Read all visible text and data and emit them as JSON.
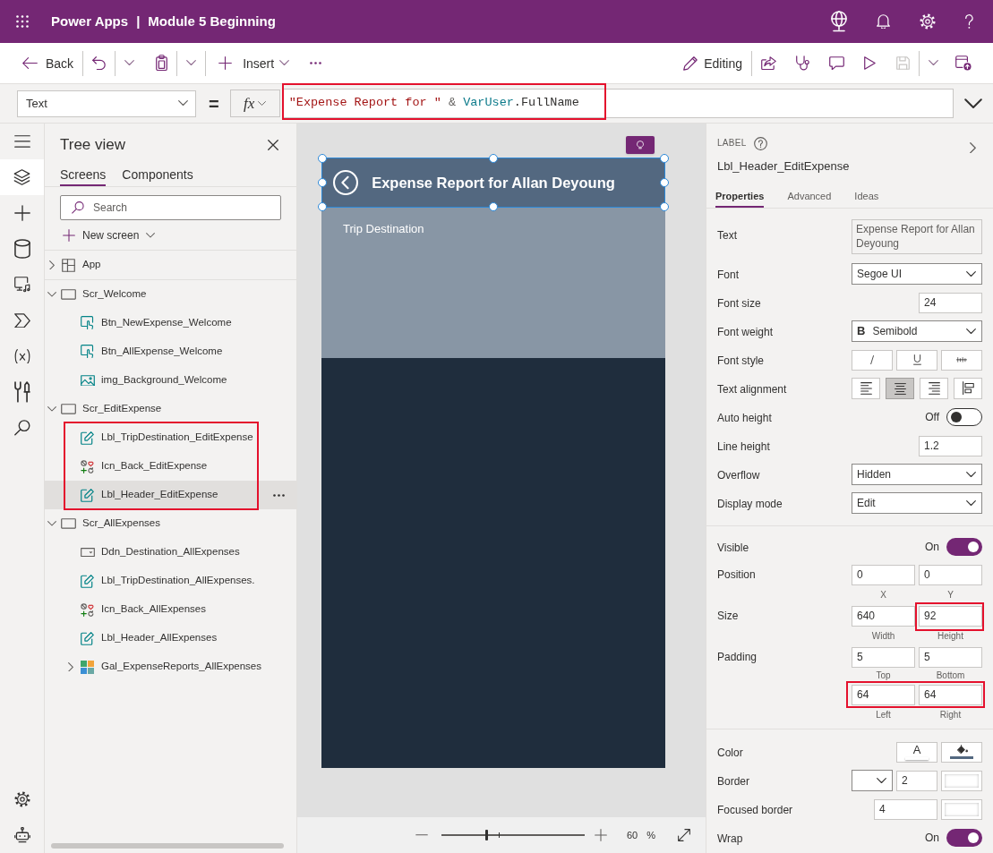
{
  "top_bar": {
    "app_name": "Power Apps",
    "separator": "|",
    "document_title": "Module 5 Beginning",
    "icons": [
      {
        "kind": "environment"
      },
      {
        "kind": "notifications"
      },
      {
        "kind": "settings"
      },
      {
        "kind": "help"
      }
    ]
  },
  "toolbar": {
    "left": [
      {
        "kind": "back",
        "label": "Back"
      },
      {
        "kind": "divider"
      },
      {
        "kind": "undo"
      },
      {
        "kind": "divider"
      },
      {
        "kind": "chevron"
      },
      {
        "kind": "paste"
      },
      {
        "kind": "divider"
      },
      {
        "kind": "chevron"
      },
      {
        "kind": "divider"
      },
      {
        "kind": "insert",
        "label": "Insert"
      },
      {
        "kind": "more"
      }
    ],
    "right": [
      {
        "kind": "editing",
        "label": "Editing"
      },
      {
        "kind": "divider"
      },
      {
        "kind": "share",
        "disabled": false
      },
      {
        "kind": "checker",
        "disabled": false
      },
      {
        "kind": "comments",
        "disabled": false
      },
      {
        "kind": "preview",
        "disabled": false
      },
      {
        "kind": "save",
        "disabled": true
      },
      {
        "kind": "divider"
      },
      {
        "kind": "chevron",
        "disabled": false
      },
      {
        "kind": "publish",
        "disabled": false
      }
    ]
  },
  "formula_bar": {
    "property": "Text",
    "operator": "=",
    "function_label": "fx",
    "formula": [
      {
        "kind": "string",
        "text": "\"Expense Report for \""
      },
      {
        "kind": "operator",
        "text": " & "
      },
      {
        "kind": "variable",
        "text": "VarUser"
      },
      {
        "kind": "member",
        "text": ".FullName"
      }
    ],
    "highlighted": true
  },
  "rail": {
    "items": [
      {
        "kind": "menu",
        "selected": false
      },
      {
        "kind": "tree",
        "selected": true
      },
      {
        "kind": "insert",
        "selected": false
      },
      {
        "kind": "data",
        "selected": false
      },
      {
        "kind": "media",
        "selected": false
      },
      {
        "kind": "automate",
        "selected": false
      },
      {
        "kind": "variables",
        "selected": false
      },
      {
        "kind": "tools",
        "selected": false
      },
      {
        "kind": "search",
        "selected": false
      }
    ],
    "bottom": [
      {
        "kind": "settings",
        "selected": false
      },
      {
        "kind": "virtual-agent",
        "selected": false
      }
    ]
  },
  "tree_view": {
    "title": "Tree view",
    "tabs": [
      {
        "label": "Screens",
        "selected": true
      },
      {
        "label": "Components",
        "selected": false
      }
    ],
    "search": {
      "placeholder": "Search"
    },
    "new_screen": "New screen",
    "items": [
      {
        "label": "App",
        "kind": "app",
        "expanded": false,
        "selected": false
      },
      {
        "label": "Scr_Welcome",
        "kind": "screen",
        "expanded": true,
        "selected": false,
        "children_highlighted": false,
        "children": [
          {
            "label": "Btn_NewExpense_Welcome",
            "kind": "button",
            "selected": false
          },
          {
            "label": "Btn_AllExpense_Welcome",
            "kind": "button",
            "selected": false
          },
          {
            "label": "img_Background_Welcome",
            "kind": "image",
            "selected": false
          }
        ]
      },
      {
        "label": "Scr_EditExpense",
        "kind": "screen",
        "expanded": true,
        "selected": false,
        "children_highlighted": true,
        "children": [
          {
            "label": "Lbl_TripDestination_EditExpense",
            "kind": "label",
            "selected": false
          },
          {
            "label": "Icn_Back_EditExpense",
            "kind": "icon",
            "selected": false
          },
          {
            "label": "Lbl_Header_EditExpense",
            "kind": "label",
            "selected": true
          }
        ]
      },
      {
        "label": "Scr_AllExpenses",
        "kind": "screen",
        "expanded": true,
        "selected": false,
        "children_highlighted": false,
        "children": [
          {
            "label": "Ddn_Destination_AllExpenses",
            "kind": "dropdown",
            "selected": false
          },
          {
            "label": "Lbl_TripDestination_AllExpenses.",
            "kind": "label",
            "selected": false
          },
          {
            "label": "Icn_Back_AllExpenses",
            "kind": "icon",
            "selected": false
          },
          {
            "label": "Lbl_Header_AllExpenses",
            "kind": "label",
            "selected": false
          },
          {
            "label": "Gal_ExpenseReports_AllExpenses",
            "kind": "gallery",
            "expanded": false,
            "selected": false
          }
        ]
      }
    ]
  },
  "canvas": {
    "screen": {
      "header": {
        "text": "Expense Report for Allan Deyoung",
        "selected": true
      },
      "section_label": "Trip Destination"
    },
    "zoom": {
      "level": 0.31,
      "value": "60",
      "unit": "%"
    }
  },
  "properties": {
    "control_type": "LABEL",
    "control_name": "Lbl_Header_EditExpense",
    "tabs": [
      {
        "label": "Properties",
        "selected": true
      },
      {
        "label": "Advanced",
        "selected": false
      },
      {
        "label": "Ideas",
        "selected": false
      }
    ],
    "sections": [
      {
        "rows": [
          {
            "kind": "controls",
            "label": "Text",
            "controls": [
              {
                "kind": "textarea",
                "value": "Expense Report for Allan Deyoung",
                "disabled": true
              }
            ]
          },
          {
            "kind": "controls",
            "label": "Font",
            "controls": [
              {
                "kind": "dropdown",
                "value": "Segoe UI"
              }
            ]
          },
          {
            "kind": "controls",
            "label": "Font size",
            "controls": [
              {
                "kind": "input",
                "value": "24"
              }
            ]
          },
          {
            "kind": "controls",
            "label": "Font weight",
            "controls": [
              {
                "kind": "dropdown",
                "prefix": "B",
                "value": "Semibold"
              }
            ]
          },
          {
            "kind": "controls",
            "label": "Font style",
            "controls": [
              {
                "kind": "italic",
                "selected": false
              },
              {
                "kind": "underline",
                "selected": false
              },
              {
                "kind": "strikethrough",
                "selected": false
              }
            ]
          },
          {
            "kind": "controls",
            "label": "Text alignment",
            "controls": [
              {
                "kind": "align-left",
                "selected": false
              },
              {
                "kind": "align-center",
                "selected": true
              },
              {
                "kind": "align-right",
                "selected": false
              },
              {
                "kind": "vertical-align",
                "selected": false
              }
            ]
          },
          {
            "kind": "controls",
            "label": "Auto height",
            "controls": [
              {
                "kind": "switch",
                "text": "Off",
                "on": false
              }
            ]
          },
          {
            "kind": "controls",
            "label": "Line height",
            "controls": [
              {
                "kind": "input",
                "value": "1.2"
              }
            ]
          },
          {
            "kind": "controls",
            "label": "Overflow",
            "controls": [
              {
                "kind": "dropdown",
                "value": "Hidden"
              }
            ]
          },
          {
            "kind": "controls",
            "label": "Display mode",
            "controls": [
              {
                "kind": "dropdown",
                "value": "Edit"
              }
            ]
          }
        ]
      },
      {
        "rows": [
          {
            "kind": "controls",
            "label": "Visible",
            "controls": [
              {
                "kind": "switch",
                "text": "On",
                "on": true
              }
            ]
          },
          {
            "kind": "pairs",
            "label": "Position",
            "pairs": [
              {
                "highlighted": false,
                "fields": [
                  {
                    "value": "0",
                    "caption": "X",
                    "highlighted": false
                  },
                  {
                    "value": "0",
                    "caption": "Y",
                    "highlighted": false
                  }
                ]
              }
            ]
          },
          {
            "kind": "pairs",
            "label": "Size",
            "pairs": [
              {
                "highlighted": false,
                "fields": [
                  {
                    "value": "640",
                    "caption": "Width",
                    "highlighted": false
                  },
                  {
                    "value": "92",
                    "caption": "Height",
                    "highlighted": true
                  }
                ]
              }
            ]
          },
          {
            "kind": "pairs",
            "label": "Padding",
            "pairs": [
              {
                "highlighted": false,
                "fields": [
                  {
                    "value": "5",
                    "caption": "Top",
                    "highlighted": false
                  },
                  {
                    "value": "5",
                    "caption": "Bottom",
                    "highlighted": false
                  }
                ]
              },
              {
                "highlighted": true,
                "fields": [
                  {
                    "value": "64",
                    "caption": "Left",
                    "highlighted": false
                  },
                  {
                    "value": "64",
                    "caption": "Right",
                    "highlighted": false
                  }
                ]
              }
            ]
          }
        ]
      },
      {
        "rows": [
          {
            "kind": "controls",
            "label": "Color",
            "controls": [
              {
                "kind": "text-color",
                "text": "A",
                "color": "#ffffff"
              },
              {
                "kind": "fill-color",
                "color": "#536880"
              }
            ]
          },
          {
            "kind": "controls",
            "label": "Border",
            "controls": [
              {
                "kind": "dropdown"
              },
              {
                "kind": "input",
                "value": "2"
              },
              {
                "kind": "swatch",
                "color": "#ffffff"
              }
            ]
          },
          {
            "kind": "controls",
            "label": "Focused border",
            "controls": [
              {
                "kind": "input",
                "value": "4"
              },
              {
                "kind": "swatch",
                "color": "#ffffff"
              }
            ]
          },
          {
            "kind": "controls",
            "label": "Wrap",
            "controls": [
              {
                "kind": "switch",
                "text": "On",
                "on": true
              }
            ]
          }
        ]
      }
    ]
  }
}
